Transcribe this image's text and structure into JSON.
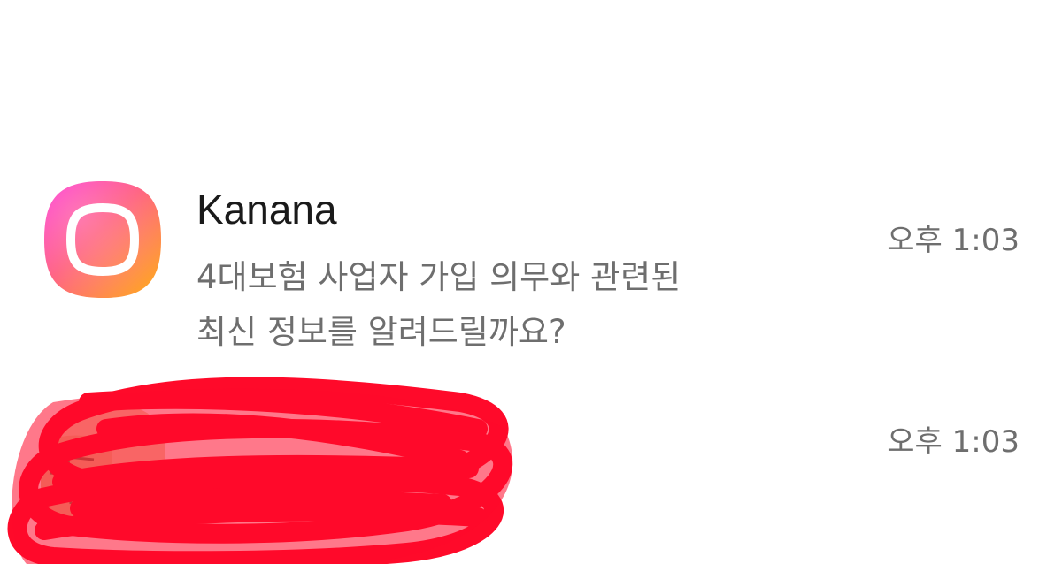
{
  "notifications": [
    {
      "app_icon": "kanana-app-icon",
      "sender": "Kanana",
      "message_lines": [
        "4대보험 사업자 가입 의무와 관련된",
        "최신 정보를 알려드릴까요?"
      ],
      "time": "오후 1:03"
    },
    {
      "app_icon": "avatar-redacted",
      "sender": "",
      "message_lines": [],
      "time": "오후 1:03"
    }
  ],
  "colors": {
    "background": "#ffffff",
    "sender_text": "#1a1a1a",
    "secondary_text": "#6e6e6e",
    "redaction": "#ff0a2a",
    "icon_gradient": [
      "#ff2fd1",
      "#ff5a7a",
      "#ffb21a"
    ]
  }
}
